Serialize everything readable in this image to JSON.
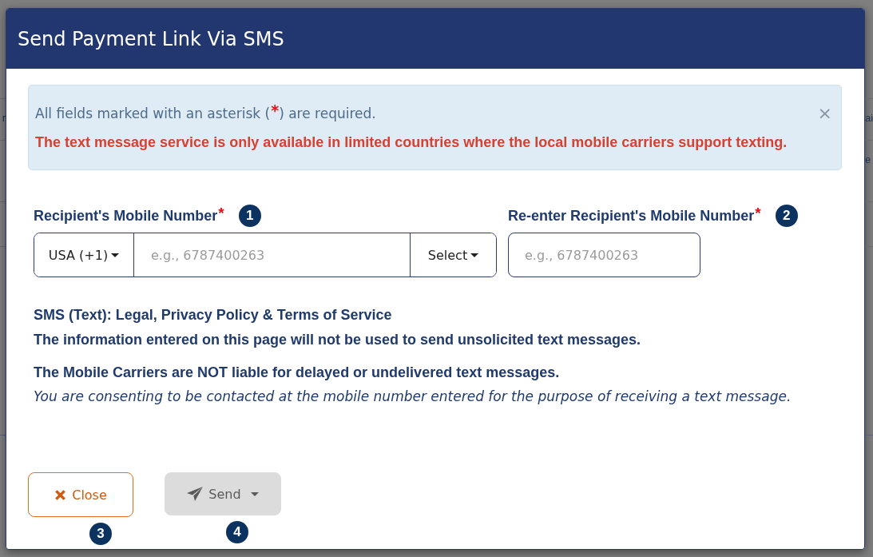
{
  "background": {
    "rows": [
      {
        "left": "r",
        "right": "ai"
      },
      {
        "right": "e"
      }
    ]
  },
  "dialog": {
    "title": "Send Payment Link Via SMS",
    "alert": {
      "required_note": {
        "before": "All fields marked with an asterisk (",
        "mark": "*",
        "after": ") are required."
      },
      "warning": "The text message service is only available in limited countries where the local mobile carriers support texting.",
      "dismiss": "×"
    },
    "fields": [
      {
        "kind": "phone_group",
        "label": "Recipient's Mobile Number",
        "required_mark": "*",
        "badge": "1",
        "country_code": "USA (+1)",
        "placeholder": "e.g., 6787400263",
        "carrier": "Select"
      },
      {
        "kind": "text",
        "label": "Re-enter Recipient's Mobile Number",
        "required_mark": "*",
        "badge": "2",
        "placeholder": "e.g., 6787400263"
      }
    ],
    "legal": [
      {
        "kind": "heading",
        "text": "SMS (Text): Legal, Privacy Policy & Terms of Service"
      },
      {
        "kind": "statement",
        "text": "The information entered on this page will not be used to send unsolicited text messages."
      },
      {
        "kind": "statement",
        "text": "The Mobile Carriers are NOT liable for delayed or undelivered text messages."
      },
      {
        "kind": "consent",
        "text": "You are consenting to be contacted at the mobile number entered for the purpose of receiving a text message."
      }
    ],
    "buttons": [
      {
        "kind": "close",
        "label": "Close",
        "badge": "3",
        "disabled": false
      },
      {
        "kind": "send",
        "label": "Send",
        "badge": "4",
        "disabled": true
      }
    ]
  }
}
